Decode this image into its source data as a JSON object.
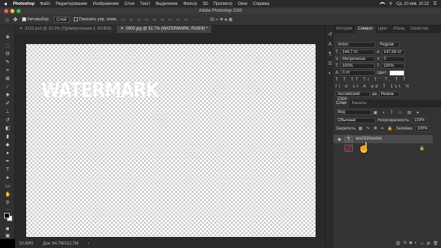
{
  "menubar": {
    "apple": "",
    "app": "Photoshop",
    "items": [
      "Файл",
      "Редактирование",
      "Изображение",
      "Слои",
      "Текст",
      "Выделение",
      "Фильтр",
      "3D",
      "Просмотр",
      "Окно",
      "Справка"
    ],
    "clock": "Ср, 10 янв. 10:22"
  },
  "window": {
    "title": "Adobe Photoshop 2020"
  },
  "options": {
    "autoselect_label": "Автовыбор:",
    "autoselect_value": "Слой",
    "transform_label": "Показать упр. элем."
  },
  "doc_tabs": [
    {
      "label": "3123.psd @ 33,3% (Прямоугольник 1, RGB/8)"
    },
    {
      "label": "0000.jpg @ 32,7% (WATERMARK, RGB/8) *"
    }
  ],
  "canvas": {
    "watermark_text": "WATERMARK"
  },
  "status": {
    "zoom": "32,69%",
    "doc": "Док: 64,7М/112,7М"
  },
  "panel_tabs": [
    "История",
    "Символ",
    "Цвет",
    "Абзац",
    "Свойства"
  ],
  "character": {
    "font_family": "Anton",
    "font_style": "Regular",
    "size": "144,7 пт",
    "leading": "147,58 пт",
    "kerning": "Метрически",
    "tracking": "0",
    "vscale": "100%",
    "hscale": "100%",
    "baseline": "0 пт",
    "color_label": "Цвет:",
    "language": "Английский: США",
    "antialias": "Резкое"
  },
  "layers_tabs": [
    "Слои",
    "Каналы"
  ],
  "layers": {
    "filter": "Вид",
    "blend": "Обычные",
    "opacity_label": "Непрозрачность:",
    "opacity": "100%",
    "lock_label": "Закрепить:",
    "fill_label": "Заливка:",
    "fill": "100%",
    "items": [
      {
        "name": "WATERMARK",
        "type": "T"
      },
      {
        "name": "",
        "type": "image"
      }
    ]
  },
  "colors": {
    "accent_text": "#ffffff",
    "canvas_check": "#cfcfcf"
  }
}
